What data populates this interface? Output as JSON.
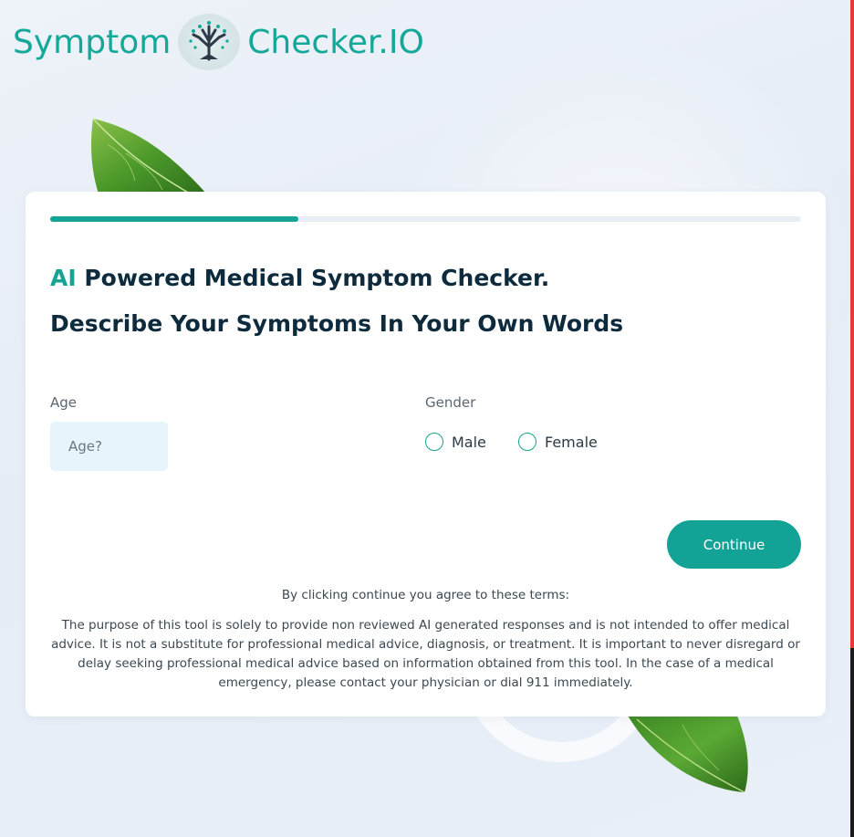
{
  "brand": {
    "name_left": "Symptom",
    "name_right": "Checker.IO",
    "color": "#14a898"
  },
  "progress": {
    "value_percent": 33
  },
  "headline": {
    "accent": "AI",
    "line1_rest": " Powered Medical Symptom Checker.",
    "line2": "Describe Your Symptoms In Your Own Words"
  },
  "form": {
    "age_label": "Age",
    "age_placeholder": "Age?",
    "age_value": "",
    "gender_label": "Gender",
    "gender_options": [
      "Male",
      "Female"
    ],
    "gender_selected": null
  },
  "continue_label": "Continue",
  "terms": {
    "title": "By clicking continue you agree to these terms:",
    "body": "The purpose of this tool is solely to provide non reviewed AI generated responses and is not intended to offer medical advice. It is not a substitute for professional medical advice, diagnosis, or treatment. It is important to never disregard or delay seeking professional medical advice based on information obtained from this tool. In the case of a medical emergency, please contact your physician or dial 911 immediately."
  },
  "colors": {
    "accent": "#15a394",
    "heading": "#0e2a3d",
    "input_bg": "#e8f4fc",
    "page_bg": "#e9eff7"
  },
  "icons": {
    "logo": "tree-icon",
    "decor": "leaf-icon"
  }
}
